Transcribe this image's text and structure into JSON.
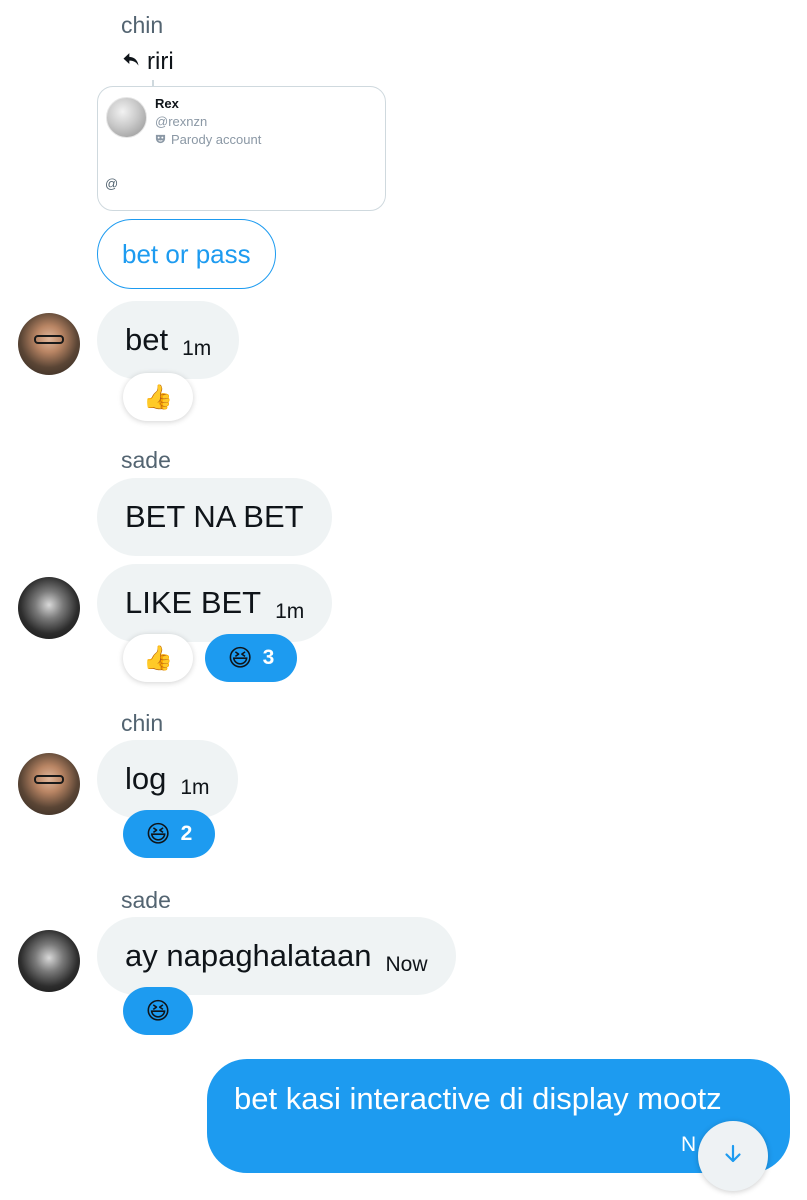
{
  "thread": {
    "first_sender": "chin",
    "reply_to": "riri",
    "quoted_card": {
      "name": "Rex",
      "handle": "@rexnzn",
      "label": "Parody account",
      "body": "@"
    },
    "quoted_text": "bet or pass"
  },
  "messages": [
    {
      "sender": "",
      "text": "bet",
      "time": "1m",
      "avatar": "chin",
      "reactions": [
        {
          "emoji": "👍",
          "count": ""
        }
      ]
    },
    {
      "sender": "sade",
      "text": "BET NA BET",
      "time": "",
      "avatar": "",
      "reactions": []
    },
    {
      "sender": "",
      "text": "LIKE BET",
      "time": "1m",
      "avatar": "sade",
      "reactions": [
        {
          "emoji": "👍",
          "count": ""
        },
        {
          "emoji": "😆",
          "count": "3"
        }
      ]
    },
    {
      "sender": "chin",
      "text": "log",
      "time": "1m",
      "avatar": "chin",
      "reactions": [
        {
          "emoji": "😆",
          "count": "2"
        }
      ]
    },
    {
      "sender": "sade",
      "text": "ay napaghalataan",
      "time": "Now",
      "avatar": "sade",
      "reactions": [
        {
          "emoji": "😆",
          "count": ""
        }
      ]
    }
  ],
  "my_message": {
    "text": "bet kasi interactive di display mootz",
    "time": "N"
  },
  "icons": {
    "reply": "reply-arrow-icon",
    "parody": "parody-mask-icon",
    "scroll_down": "arrow-down-icon"
  },
  "colors": {
    "accent": "#1d9bf0",
    "bubble_gray": "#eff3f4",
    "secondary_text": "#536471"
  }
}
